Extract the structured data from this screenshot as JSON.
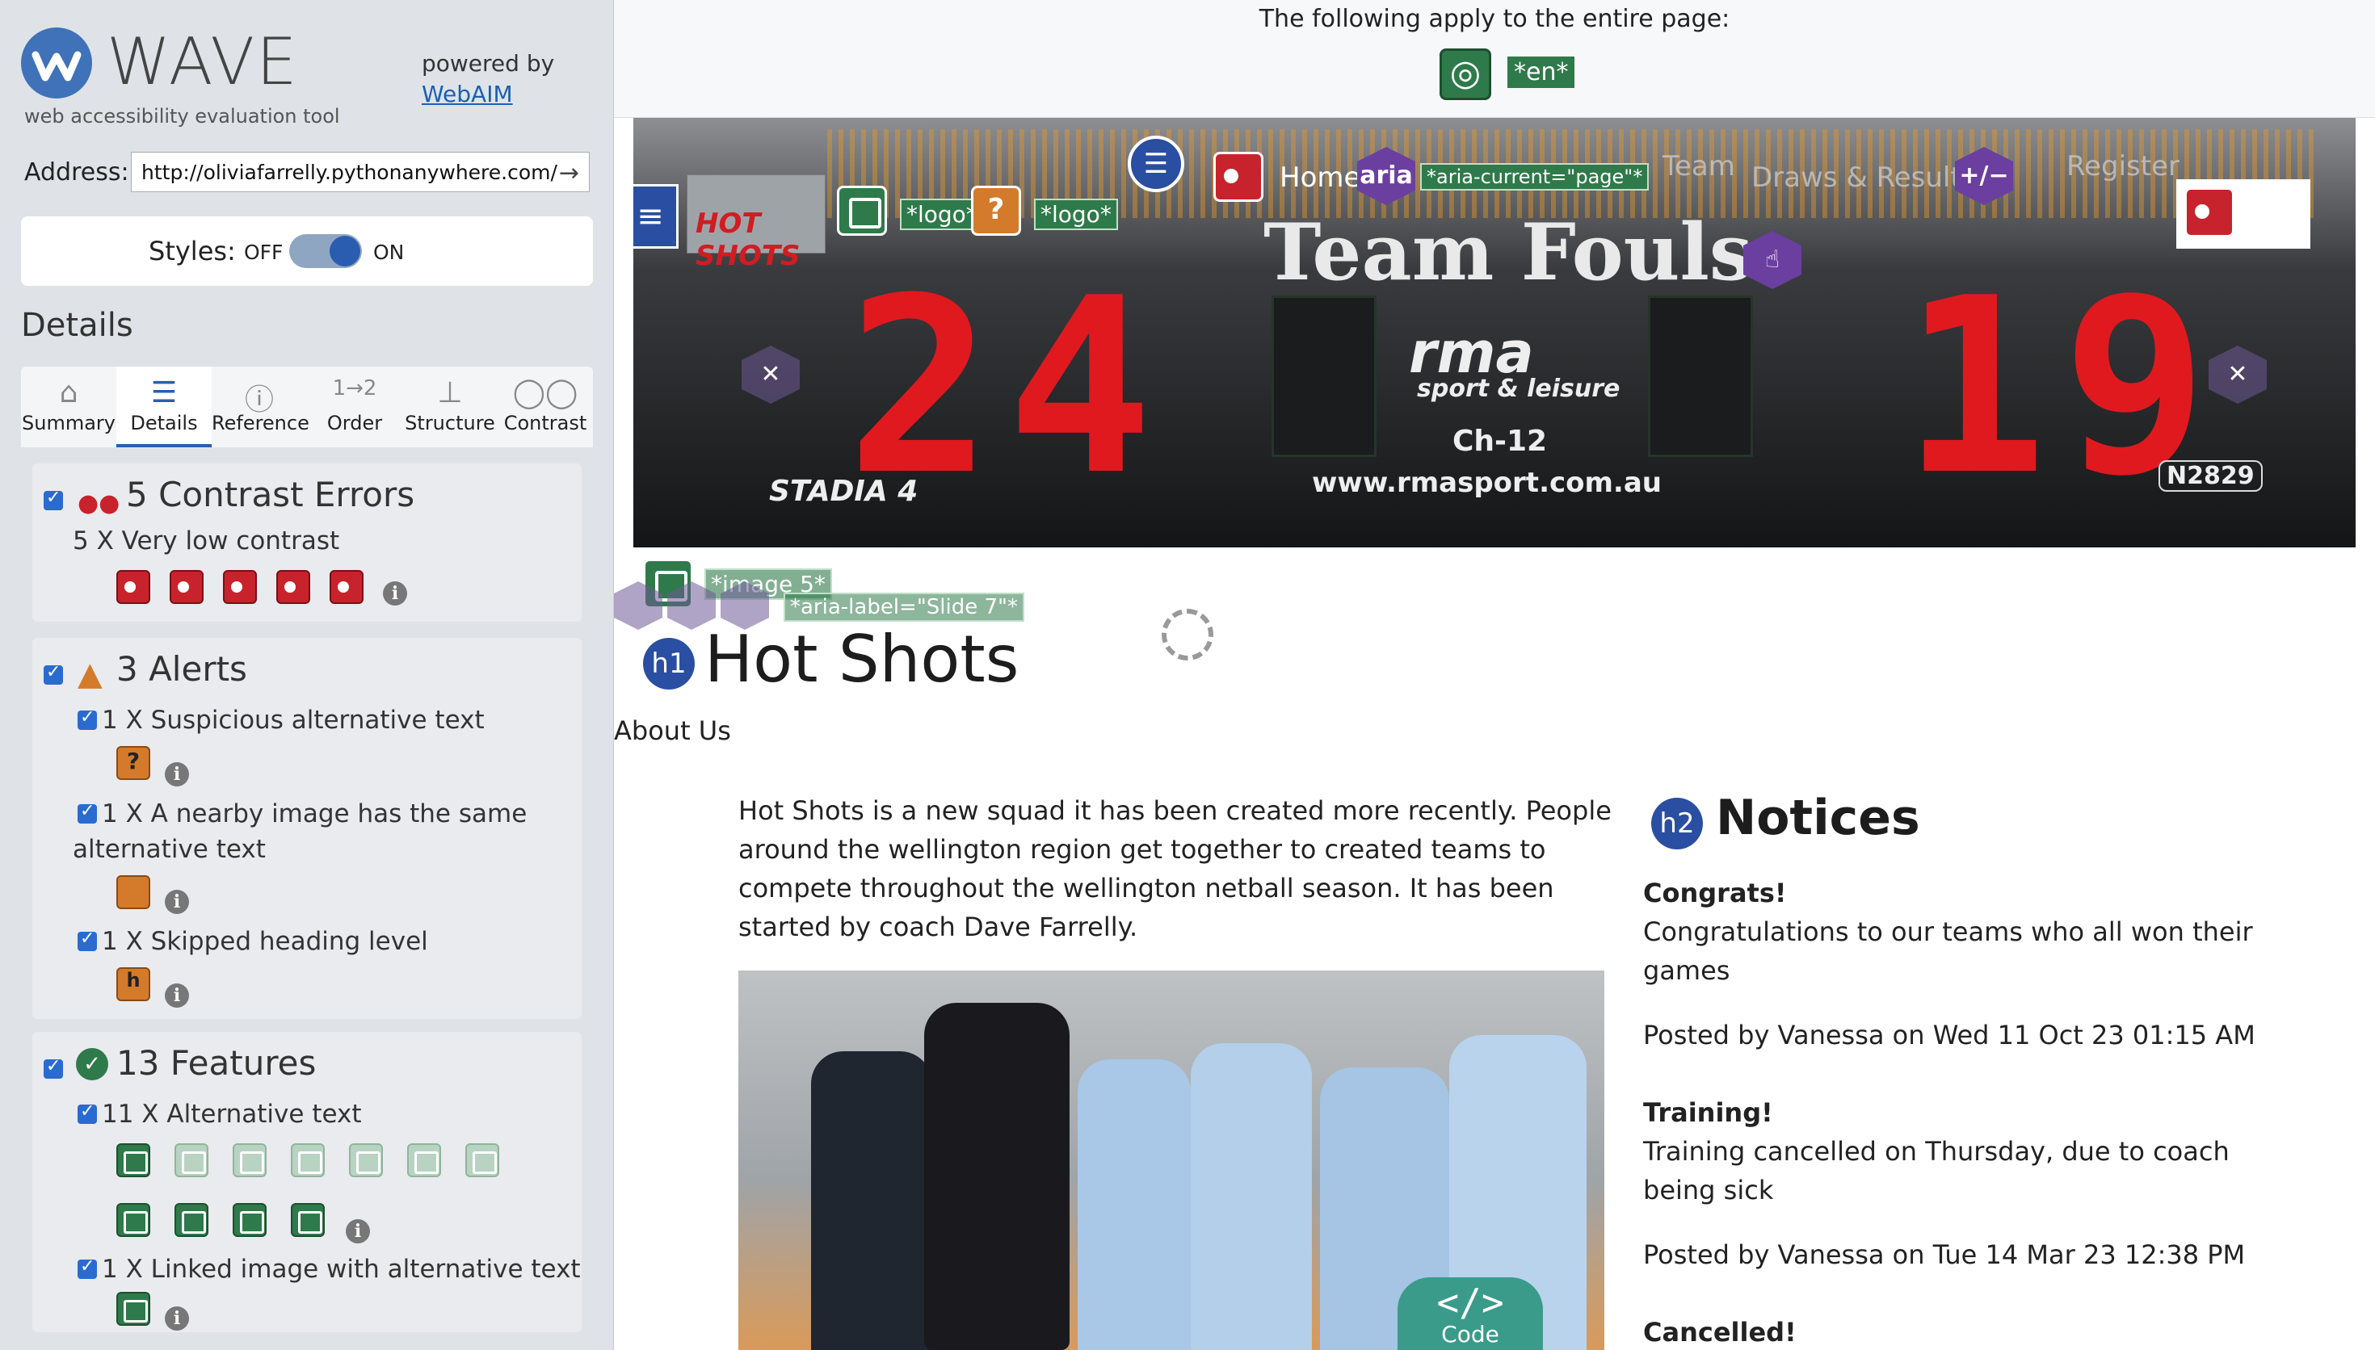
{
  "wave": {
    "title": "WAVE",
    "subtitle": "web accessibility evaluation tool",
    "powered_by": "powered by",
    "webaim": "WebAIM",
    "address_label": "Address:",
    "address_value": "http://oliviafarrelly.pythonanywhere.com/",
    "styles_label": "Styles:",
    "styles_off": "OFF",
    "styles_on": "ON",
    "details_heading": "Details",
    "tabs": [
      {
        "label": "Summary",
        "icon": "home-icon"
      },
      {
        "label": "Details",
        "icon": "list-icon"
      },
      {
        "label": "Reference",
        "icon": "info-icon"
      },
      {
        "label": "Order",
        "icon": "order-icon"
      },
      {
        "label": "Structure",
        "icon": "structure-icon"
      },
      {
        "label": "Contrast",
        "icon": "contrast-icon"
      }
    ],
    "active_tab": "Details",
    "errors": {
      "heading": "5 Contrast Errors",
      "item": "5 X Very low contrast",
      "count": 5
    },
    "alerts": {
      "heading": "3 Alerts",
      "items": [
        "1 X Suspicious alternative text",
        "1 X A nearby image has the same alternative text",
        "1 X Skipped heading level"
      ]
    },
    "features": {
      "heading": "13 Features",
      "items": [
        "11 X Alternative text",
        "1 X Linked image with alternative text"
      ]
    }
  },
  "page": {
    "apply_text": "The following apply to the entire page:",
    "lang_tag": "*en*",
    "nav": {
      "home": "Home",
      "aria": "aria",
      "aria_current": "*aria-current=\"page\"*",
      "team": "Team",
      "draws": "Draws & Results",
      "plusminus": "+/−",
      "register": "Register",
      "logo_tag_1": "*logo*",
      "logo_tag_2": "*logo*",
      "logo_text": "HOT SHOTS"
    },
    "scoreboard": {
      "team_fouls": "Team Fouls",
      "left": "24",
      "right": "19",
      "rma": "rma",
      "sport": "sport & leisure",
      "channel": "Ch-12",
      "url": "www.rmasport.com.au",
      "stadia": "STADIA 4",
      "model": "N2829"
    },
    "slide_tags": {
      "image": "*image 5*",
      "aria_label": "*aria-label=\"Slide 7\"*"
    },
    "h1_badge": "h1",
    "title": "Hot Shots",
    "about": "About Us",
    "intro": "Hot Shots is a new squad it has been created more recently. People around the wellington region get together to created teams to compete throughout the wellington netball season. It has been started by coach Dave Farrelly.",
    "code_label": "Code",
    "h2_badge": "h2",
    "notices_heading": "Notices",
    "notices": [
      {
        "title": "Congrats!",
        "body": "Congratulations to our teams who all won their games",
        "posted": "Posted by Vanessa on Wed 11 Oct 23 01:15 AM"
      },
      {
        "title": "Training!",
        "body": "Training cancelled on Thursday, due to coach being sick",
        "posted": "Posted by Vanessa on Tue 14 Mar 23 12:38 PM"
      },
      {
        "title": "Cancelled!",
        "body": "",
        "posted": ""
      }
    ]
  },
  "colors": {
    "error": "#c8232c",
    "alert": "#d47a2b",
    "feature": "#2f7a4a",
    "structure": "#2a4ea1",
    "aria": "#6b3fa0"
  }
}
